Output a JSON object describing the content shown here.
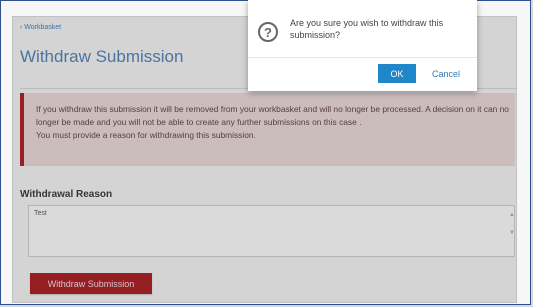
{
  "breadcrumb": "‹ Workbasket",
  "page_title": "Withdraw Submission",
  "alert": {
    "line1": "If you withdraw this submission it will be removed from your workbasket and will no longer be processed. A decision on it can no longer be made and you will not be able to create any further submissions on this case .",
    "line2": "You must provide a reason for withdrawing this submission."
  },
  "reason": {
    "label": "Withdrawal Reason",
    "value": "Test"
  },
  "submit_label": "Withdraw Submission",
  "dialog": {
    "icon": "?",
    "message": "Are you sure you wish to withdraw this submission?",
    "ok_label": "OK",
    "cancel_label": "Cancel"
  },
  "colors": {
    "accent": "#1f86c8",
    "danger": "#a6151c",
    "title": "#4a7fb3"
  },
  "icons": {
    "dialog": "question-icon",
    "breadcrumb": "chevron-left-icon"
  }
}
